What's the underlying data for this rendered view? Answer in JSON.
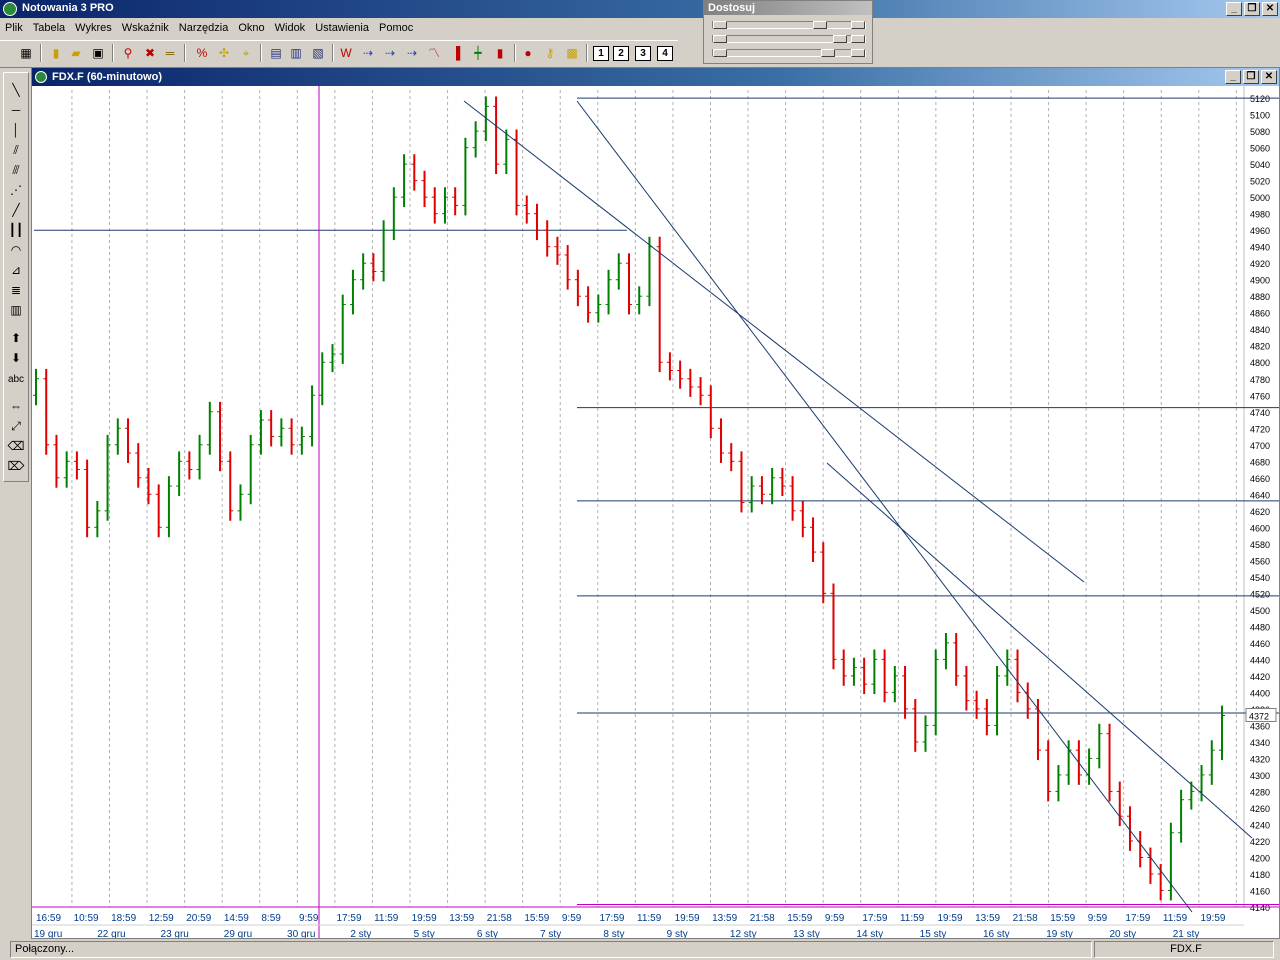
{
  "app": {
    "title": "Notowania 3 PRO"
  },
  "menu": {
    "items": [
      "Plik",
      "Tabela",
      "Wykres",
      "Wskaźnik",
      "Narzędzia",
      "Okno",
      "Widok",
      "Ustawienia",
      "Pomoc"
    ]
  },
  "dostosuj": {
    "title": "Dostosuj"
  },
  "toolbar": {
    "num1": "1",
    "num2": "2",
    "num3": "3",
    "num4": "4"
  },
  "lefttools": {
    "text_tool": "abc"
  },
  "chart_window": {
    "title": "FDX.F (60-minutowo)"
  },
  "status": {
    "connection": "Połączony...",
    "symbol": "FDX.F"
  },
  "colors": {
    "up": "#008000",
    "down": "#e00000",
    "line": "#1a3a6e",
    "vline": "#c000c0",
    "grid": "#b0b0b0"
  },
  "chart_data": {
    "type": "bar",
    "subtype": "ohlc",
    "ylim": [
      4140,
      5125
    ],
    "y_ticks": [
      5120,
      5100,
      5080,
      5060,
      5040,
      5020,
      5000,
      4980,
      4960,
      4940,
      4920,
      4900,
      4880,
      4860,
      4840,
      4820,
      4800,
      4780,
      4760,
      4740,
      4720,
      4700,
      4680,
      4660,
      4640,
      4620,
      4600,
      4580,
      4560,
      4540,
      4520,
      4500,
      4480,
      4460,
      4440,
      4420,
      4400,
      4380,
      4360,
      4340,
      4320,
      4300,
      4280,
      4260,
      4240,
      4220,
      4200,
      4180,
      4160,
      4140
    ],
    "last_price": "4372",
    "x_time_labels": [
      "16:59",
      "10:59",
      "18:59",
      "12:59",
      "20:59",
      "14:59",
      "8:59",
      "9:59",
      "17:59",
      "11:59",
      "19:59",
      "13:59",
      "21:58",
      "15:59",
      "9:59",
      "17:59",
      "11:59",
      "19:59",
      "13:59",
      "21:58",
      "15:59",
      "9:59",
      "17:59",
      "11:59",
      "19:59",
      "13:59",
      "21:58",
      "15:59",
      "9:59",
      "17:59",
      "11:59",
      "19:59"
    ],
    "x_date_labels": [
      "19 gru",
      "22 gru",
      "23 gru",
      "29 gru",
      "30 gru",
      "2 sty",
      "5 sty",
      "6 sty",
      "7 sty",
      "8 sty",
      "9 sty",
      "12 sty",
      "13 sty",
      "14 sty",
      "15 sty",
      "16 sty",
      "19 sty",
      "20 sty",
      "21 sty"
    ],
    "horizontal_levels": [
      5120,
      4960,
      4745,
      4632,
      4517,
      4375,
      4143
    ],
    "series": [
      {
        "values_close": [
          4780,
          4700,
          4660,
          4680,
          4670,
          4600,
          4620,
          4700,
          4720,
          4690,
          4660,
          4640,
          4600,
          4650,
          4680,
          4670,
          4700,
          4740,
          4680,
          4620,
          4640,
          4700,
          4730,
          4710,
          4720,
          4700,
          4710,
          4760,
          4800,
          4810,
          4870,
          4900,
          4920,
          4910,
          4960,
          5000,
          5040,
          5020,
          5000,
          4980,
          5000,
          4990,
          5060,
          5080,
          5110,
          5040,
          5070,
          4990,
          4980,
          4960,
          4940,
          4930,
          4900,
          4880,
          4860,
          4870,
          4900,
          4920,
          4870,
          4880,
          4940,
          4800,
          4790,
          4780,
          4770,
          4760,
          4720,
          4690,
          4680,
          4630,
          4650,
          4640,
          4660,
          4650,
          4620,
          4600,
          4570,
          4520,
          4440,
          4420,
          4430,
          4410,
          4440,
          4400,
          4420,
          4380,
          4340,
          4360,
          4440,
          4460,
          4420,
          4390,
          4380,
          4360,
          4420,
          4440,
          4400,
          4380,
          4330,
          4280,
          4300,
          4330,
          4300,
          4320,
          4350,
          4280,
          4250,
          4220,
          4200,
          4180,
          4160,
          4230,
          4270,
          4280,
          4300,
          4330,
          4372
        ]
      }
    ]
  }
}
